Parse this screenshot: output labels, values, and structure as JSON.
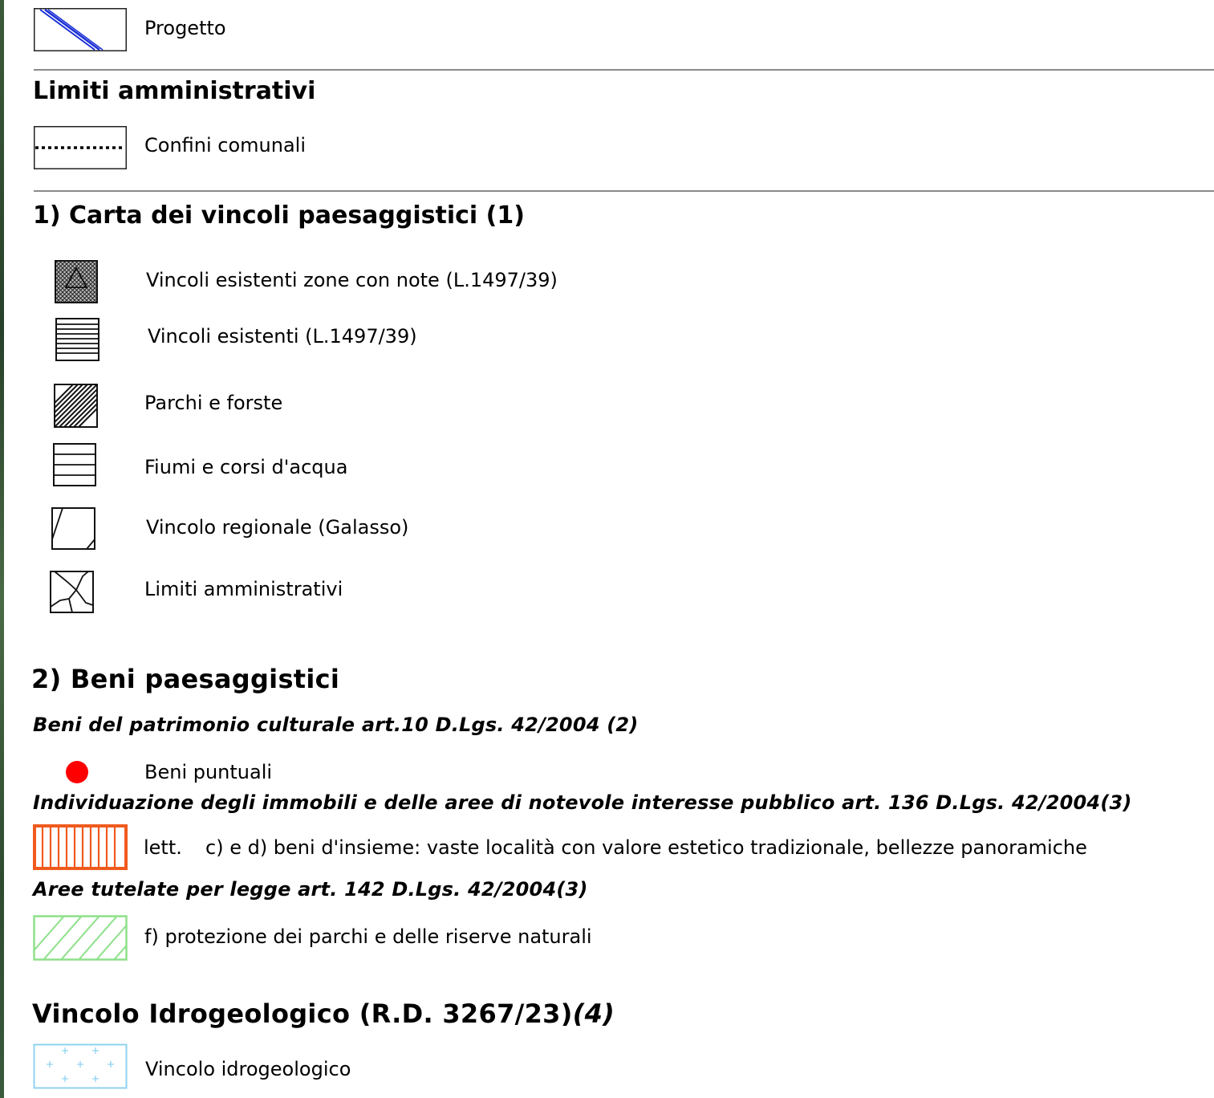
{
  "legend": {
    "progetto": {
      "label": "Progetto",
      "color": "#1a2fd6"
    },
    "limiti_amministrativi": {
      "heading": "Limiti amministrativi",
      "confini_label": "Confini comunali"
    },
    "carta_vincoli": {
      "heading": "1) Carta dei vincoli paesaggistici (1)",
      "items": [
        {
          "label": "Vincoli esistenti zone con note (L.1497/39)",
          "icon": "cross-hatch-triangle-icon"
        },
        {
          "label": "Vincoli esistenti (L.1497/39)",
          "icon": "horizontal-lines-icon"
        },
        {
          "label": "Parchi e forste",
          "icon": "diagonal-hatch-icon"
        },
        {
          "label": "Fiumi e corsi d'acqua",
          "icon": "horizontal-bands-icon"
        },
        {
          "label": "Vincolo regionale (Galasso)",
          "icon": "outline-slash-icon"
        },
        {
          "label": "Limiti amministrativi",
          "icon": "boundary-lines-icon"
        }
      ]
    },
    "beni_paesaggistici": {
      "heading": "2) Beni paesaggistici",
      "patrimonio": {
        "heading": "Beni del patrimonio culturale art.10 D.Lgs. 42/2004 (2)",
        "beni_puntuali_label": "Beni puntuali",
        "point_color": "#ff0000"
      },
      "immobili": {
        "heading": "Individuazione degli immobili e delle aree di notevole interesse pubblico art. 136 D.Lgs. 42/2004(3)",
        "lett_prefix": "lett.",
        "lett_text": "c) e d) beni d'insieme: vaste località con valore estetico tradizionale, bellezze panoramiche",
        "color": "#f05a1e"
      },
      "aree_tutelate": {
        "heading": "Aree tutelate per legge art. 142 D.Lgs. 42/2004(3)",
        "parchi_label": "f) protezione dei parchi e delle riserve naturali",
        "color": "#8ee08a"
      }
    },
    "vincolo_idrogeologico": {
      "heading_main": "Vincolo Idrogeologico (R.D. 3267/23)",
      "heading_note": "(4)",
      "label": "Vincolo idrogeologico",
      "color": "#8fd3f0"
    }
  }
}
